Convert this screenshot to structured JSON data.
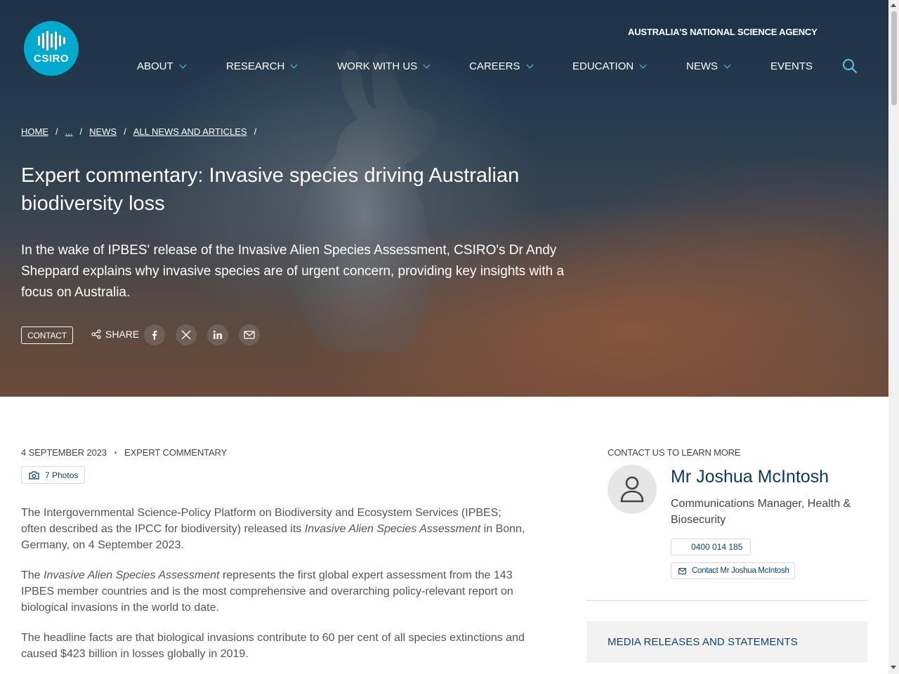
{
  "header": {
    "logo_text": "CSIRO",
    "tagline": "AUSTRALIA'S NATIONAL SCIENCE AGENCY",
    "nav": [
      {
        "label": "ABOUT",
        "has_dropdown": true
      },
      {
        "label": "RESEARCH",
        "has_dropdown": true
      },
      {
        "label": "WORK WITH US",
        "has_dropdown": true
      },
      {
        "label": "CAREERS",
        "has_dropdown": true
      },
      {
        "label": "EDUCATION",
        "has_dropdown": true
      },
      {
        "label": "NEWS",
        "has_dropdown": true
      },
      {
        "label": "EVENTS",
        "has_dropdown": false
      }
    ],
    "accent_color": "#00a9ce"
  },
  "breadcrumb": {
    "items": [
      "HOME",
      "...",
      "NEWS",
      "ALL NEWS AND ARTICLES"
    ],
    "separator": "/"
  },
  "article": {
    "title": "Expert commentary: Invasive species driving Australian biodiversity loss",
    "lead": "In the wake of IPBES' release of the Invasive Alien Species Assessment, CSIRO's Dr Andy Sheppard explains why invasive species are of urgent concern, providing key insights with a focus on Australia.",
    "contact_label": "CONTACT",
    "share_label": "SHARE",
    "share_icons": [
      "facebook-icon",
      "x-icon",
      "linkedin-icon",
      "email-icon"
    ],
    "date": "4 SEPTEMBER 2023",
    "meta_separator": "•",
    "category": "EXPERT COMMENTARY",
    "photos_label": "7 Photos",
    "paragraphs": [
      {
        "before": "The Intergovernmental Science-Policy Platform on Biodiversity and Ecosystem Services (IPBES; often described as the IPCC for biodiversity) released its ",
        "em": "Invasive Alien Species Assessment",
        "after": " in Bonn, Germany, on 4 September 2023."
      },
      {
        "before": "The ",
        "em": "Invasive Alien Species Assessment",
        "after": " represents the first global expert assessment from the 143 IPBES member countries and is the most comprehensive and overarching policy-relevant report on biological invasions in the world to date."
      },
      {
        "before": "The headline facts are that biological invasions contribute to 60 per cent of all species extinctions and caused $423 billion in losses globally in 2019.",
        "em": "",
        "after": ""
      }
    ]
  },
  "sidebar": {
    "label": "CONTACT US TO LEARN MORE",
    "name": "Mr Joshua McIntosh",
    "role": "Communications Manager, Health & Biosecurity",
    "phone": "0400 014 185",
    "email_label": "Contact Mr Joshua McIntosh",
    "media_box_label": "MEDIA RELEASES AND STATEMENTS"
  }
}
